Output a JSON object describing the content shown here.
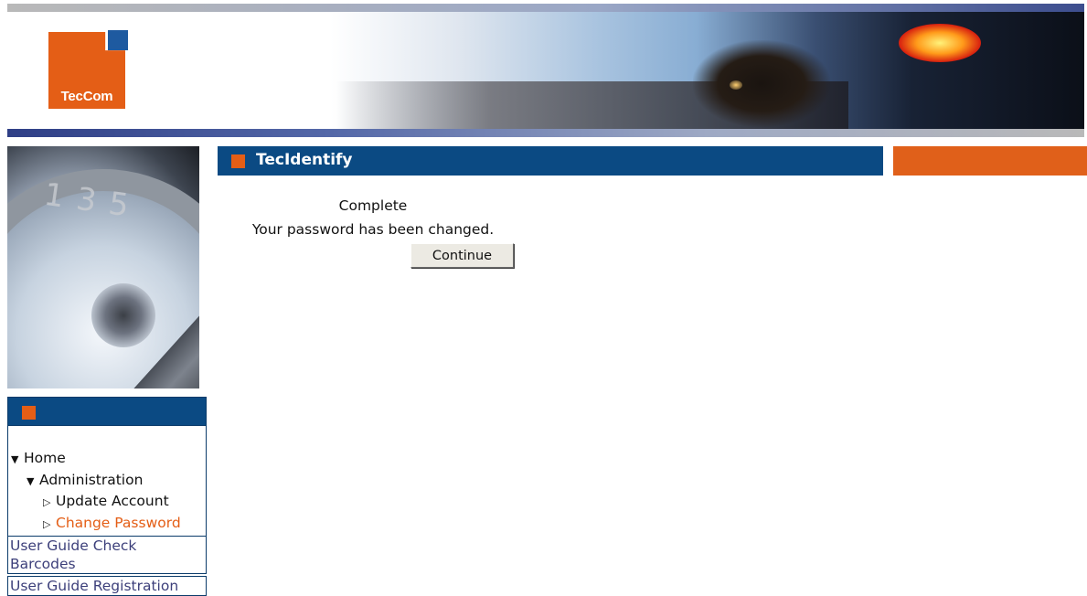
{
  "brand": {
    "logo_text": "TecCom"
  },
  "main": {
    "title": "TecIdentify",
    "status_heading": "Complete",
    "status_message": "Your password has been changed.",
    "continue_label": "Continue"
  },
  "nav": {
    "tree": [
      {
        "label": "Home",
        "level": 0,
        "expanded": true,
        "active": false
      },
      {
        "label": "Administration",
        "level": 1,
        "expanded": true,
        "active": false
      },
      {
        "label": "Update Account",
        "level": 2,
        "expanded": false,
        "active": false
      },
      {
        "label": "Change Password",
        "level": 2,
        "expanded": false,
        "active": true
      }
    ],
    "links": [
      {
        "label": "User Guide Check Barcodes"
      },
      {
        "label": "User Guide Registration"
      }
    ]
  },
  "colors": {
    "header_blue": "#0b4a83",
    "accent_orange": "#e45e16",
    "active_link": "#e45e16",
    "guide_link": "#3c3f7a"
  },
  "icons": {
    "expanded": "triangle-down-icon",
    "collapsed": "triangle-right-outline-icon"
  }
}
